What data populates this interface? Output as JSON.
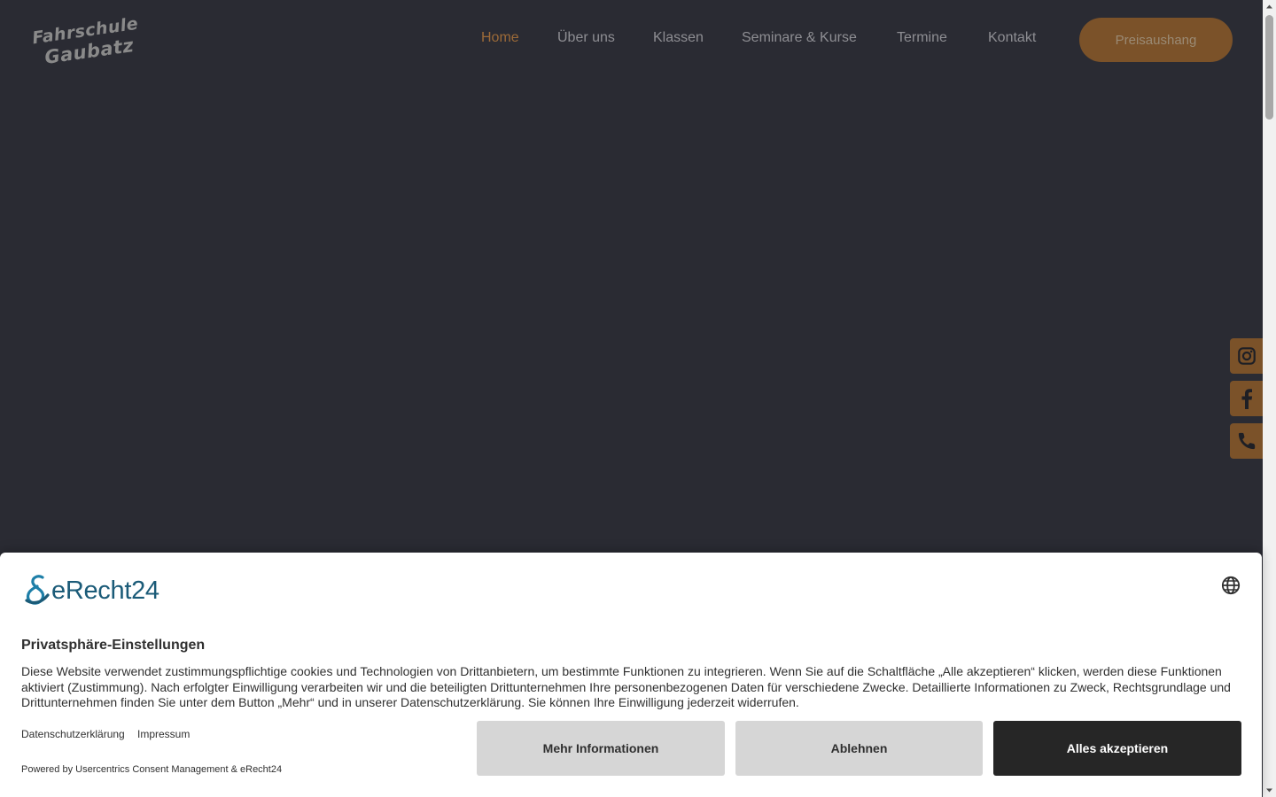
{
  "logo": {
    "line1": "Fahrschule",
    "line2": "Gaubatz"
  },
  "nav": {
    "items": [
      {
        "label": "Home",
        "active": true
      },
      {
        "label": "Über uns"
      },
      {
        "label": "Klassen"
      },
      {
        "label": "Seminare & Kurse"
      },
      {
        "label": "Termine"
      },
      {
        "label": "Kontakt"
      }
    ],
    "cta_label": "Preisaushang"
  },
  "social": [
    "instagram-icon",
    "facebook-icon",
    "phone-icon"
  ],
  "colors": {
    "background": "#2a2b33",
    "accent": "#7b5229",
    "active_nav": "#9c6a38"
  },
  "consent": {
    "brand": "eRecht24",
    "title": "Privatsphäre-Einstellungen",
    "description": "Diese Website verwendet zustimmungspflichtige cookies und Technologien von Drittanbietern, um bestimmte Funktionen zu integrieren. Wenn Sie auf die Schaltfläche „Alle akzeptieren“ klicken, werden diese Funktionen aktiviert (Zustimmung). Nach erfolgter Einwilligung verarbeiten wir und die beteiligten Drittunternehmen Ihre personenbezogenen Daten für verschiedene Zwecke. Detaillierte Informationen zu Zweck, Rechtsgrundlage und Drittunternehmen finden Sie unter dem Button „Mehr“ und in unserer Datenschutzerklärung. Sie können Ihre Einwilligung jederzeit widerrufen.",
    "links": [
      "Datenschutzerklärung",
      "Impressum"
    ],
    "powered_by": "Powered by Usercentrics Consent Management & eRecht24",
    "buttons": {
      "more": "Mehr Informationen",
      "decline": "Ablehnen",
      "accept": "Alles akzeptieren"
    }
  }
}
